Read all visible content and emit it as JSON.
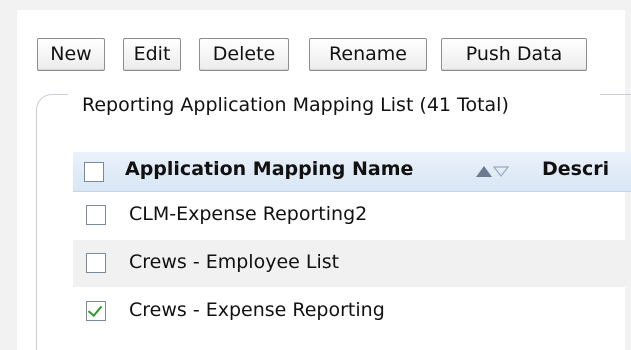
{
  "toolbar": {
    "buttons": [
      {
        "label": "New"
      },
      {
        "label": "Edit"
      },
      {
        "label": "Delete"
      },
      {
        "label": "Rename"
      },
      {
        "label": "Push Data"
      }
    ]
  },
  "list": {
    "legend": "Reporting Application Mapping List (41 Total)",
    "columns": [
      {
        "label": "Application Mapping Name",
        "sort": "ascending"
      },
      {
        "label": "Descri"
      }
    ],
    "rows": [
      {
        "name": "CLM-Expense Reporting2",
        "checked": false
      },
      {
        "name": "Crews - Employee List",
        "checked": false
      },
      {
        "name": "Crews - Expense Reporting",
        "checked": true
      }
    ]
  },
  "colors": {
    "header_bg": "#dce8f6",
    "sort_icon": "#6a7a90",
    "check": "#2e9b2e"
  }
}
